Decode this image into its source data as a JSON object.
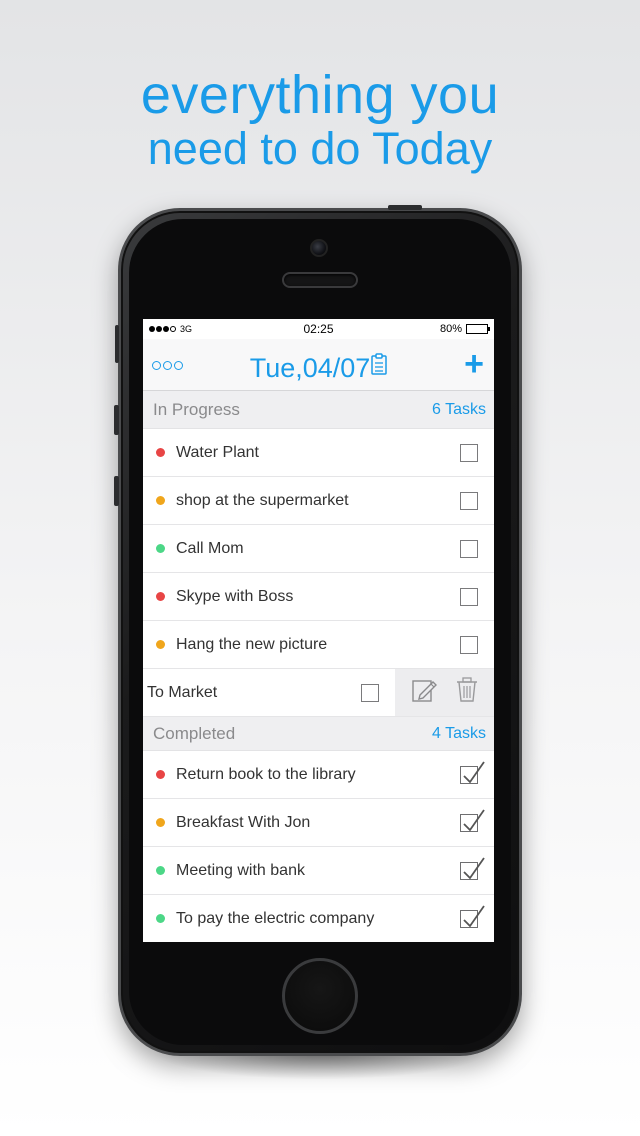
{
  "headline": {
    "line1": "everything you",
    "line2": "need to do Today"
  },
  "status": {
    "carrier": "3G",
    "time": "02:25",
    "battery": "80%",
    "battery_level": 0.8
  },
  "nav": {
    "title": "Tue,04/07",
    "add": "+"
  },
  "colors": {
    "accent": "#1a9be8",
    "red": "#e84545",
    "orange": "#f0a61c",
    "green": "#4cd787"
  },
  "in_progress": {
    "name": "In Progress",
    "count": "6 Tasks",
    "tasks": [
      {
        "label": "Water Plant",
        "priority": "red"
      },
      {
        "label": "shop at the supermarket",
        "priority": "orange"
      },
      {
        "label": "Call Mom",
        "priority": "green"
      },
      {
        "label": "Skype with Boss",
        "priority": "red"
      },
      {
        "label": "Hang the new picture",
        "priority": "orange"
      }
    ],
    "swiped_task": {
      "label": "To Market"
    }
  },
  "completed": {
    "name": "Completed",
    "count": "4 Tasks",
    "tasks": [
      {
        "label": "Return book to the library",
        "priority": "red"
      },
      {
        "label": "Breakfast With Jon",
        "priority": "orange"
      },
      {
        "label": "Meeting with bank",
        "priority": "green"
      },
      {
        "label": "To pay the electric company",
        "priority": "green"
      }
    ]
  }
}
